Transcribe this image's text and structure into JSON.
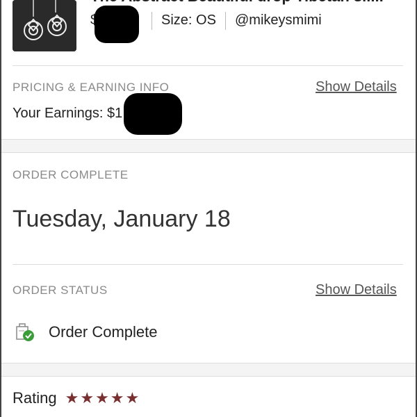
{
  "product": {
    "title": "The Abstract Beautiful drop Tibetan sil...",
    "price_prefix": "$",
    "size": "Size: OS",
    "seller": "@mikeysmimi"
  },
  "pricing": {
    "heading": "PRICING & EARNING INFO",
    "link": "Show Details",
    "earnings_prefix": "Your Earnings: $1"
  },
  "order_complete": {
    "heading": "ORDER COMPLETE",
    "date": "Tuesday, January 18"
  },
  "order_status": {
    "heading": "ORDER STATUS",
    "link": "Show Details",
    "status": "Order Complete",
    "status_icon": "order-complete-check-icon",
    "status_color": "#3a9d3a"
  },
  "rating": {
    "label": "Rating",
    "stars": 5,
    "star_color": "#7a2f2f"
  }
}
